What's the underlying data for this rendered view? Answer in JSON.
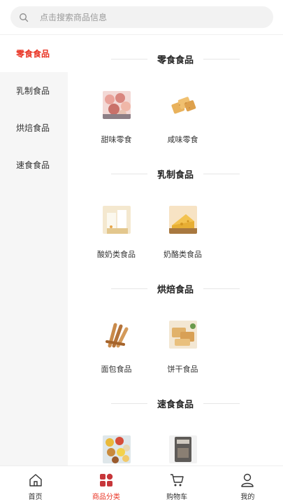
{
  "search": {
    "placeholder": "点击搜索商品信息"
  },
  "sidebar": {
    "items": [
      {
        "label": "零食食品",
        "active": true
      },
      {
        "label": "乳制食品",
        "active": false
      },
      {
        "label": "烘焙食品",
        "active": false
      },
      {
        "label": "速食食品",
        "active": false
      }
    ]
  },
  "sections": [
    {
      "title": "零食食品",
      "products": [
        {
          "name": "甜味零食",
          "icon": "sweet-snack-image"
        },
        {
          "name": "咸味零食",
          "icon": "cracker-image"
        }
      ]
    },
    {
      "title": "乳制食品",
      "products": [
        {
          "name": "酸奶类食品",
          "icon": "yogurt-image"
        },
        {
          "name": "奶酪类食品",
          "icon": "cheese-image"
        }
      ]
    },
    {
      "title": "烘焙食品",
      "products": [
        {
          "name": "面包食品",
          "icon": "bread-image"
        },
        {
          "name": "饼干食品",
          "icon": "biscuit-image"
        }
      ]
    },
    {
      "title": "速食食品",
      "products": [
        {
          "name": "",
          "icon": "spice-bowls-image"
        },
        {
          "name": "",
          "icon": "instant-pack-image"
        }
      ]
    }
  ],
  "tabbar": {
    "items": [
      {
        "label": "首页",
        "icon": "home-icon",
        "active": false
      },
      {
        "label": "商品分类",
        "icon": "category-icon",
        "active": true
      },
      {
        "label": "购物车",
        "icon": "cart-icon",
        "active": false
      },
      {
        "label": "我的",
        "icon": "user-icon",
        "active": false
      }
    ]
  },
  "colors": {
    "accent": "#e93323",
    "sidebar_bg": "#f6f6f6",
    "search_bg": "#f2f2f2"
  }
}
